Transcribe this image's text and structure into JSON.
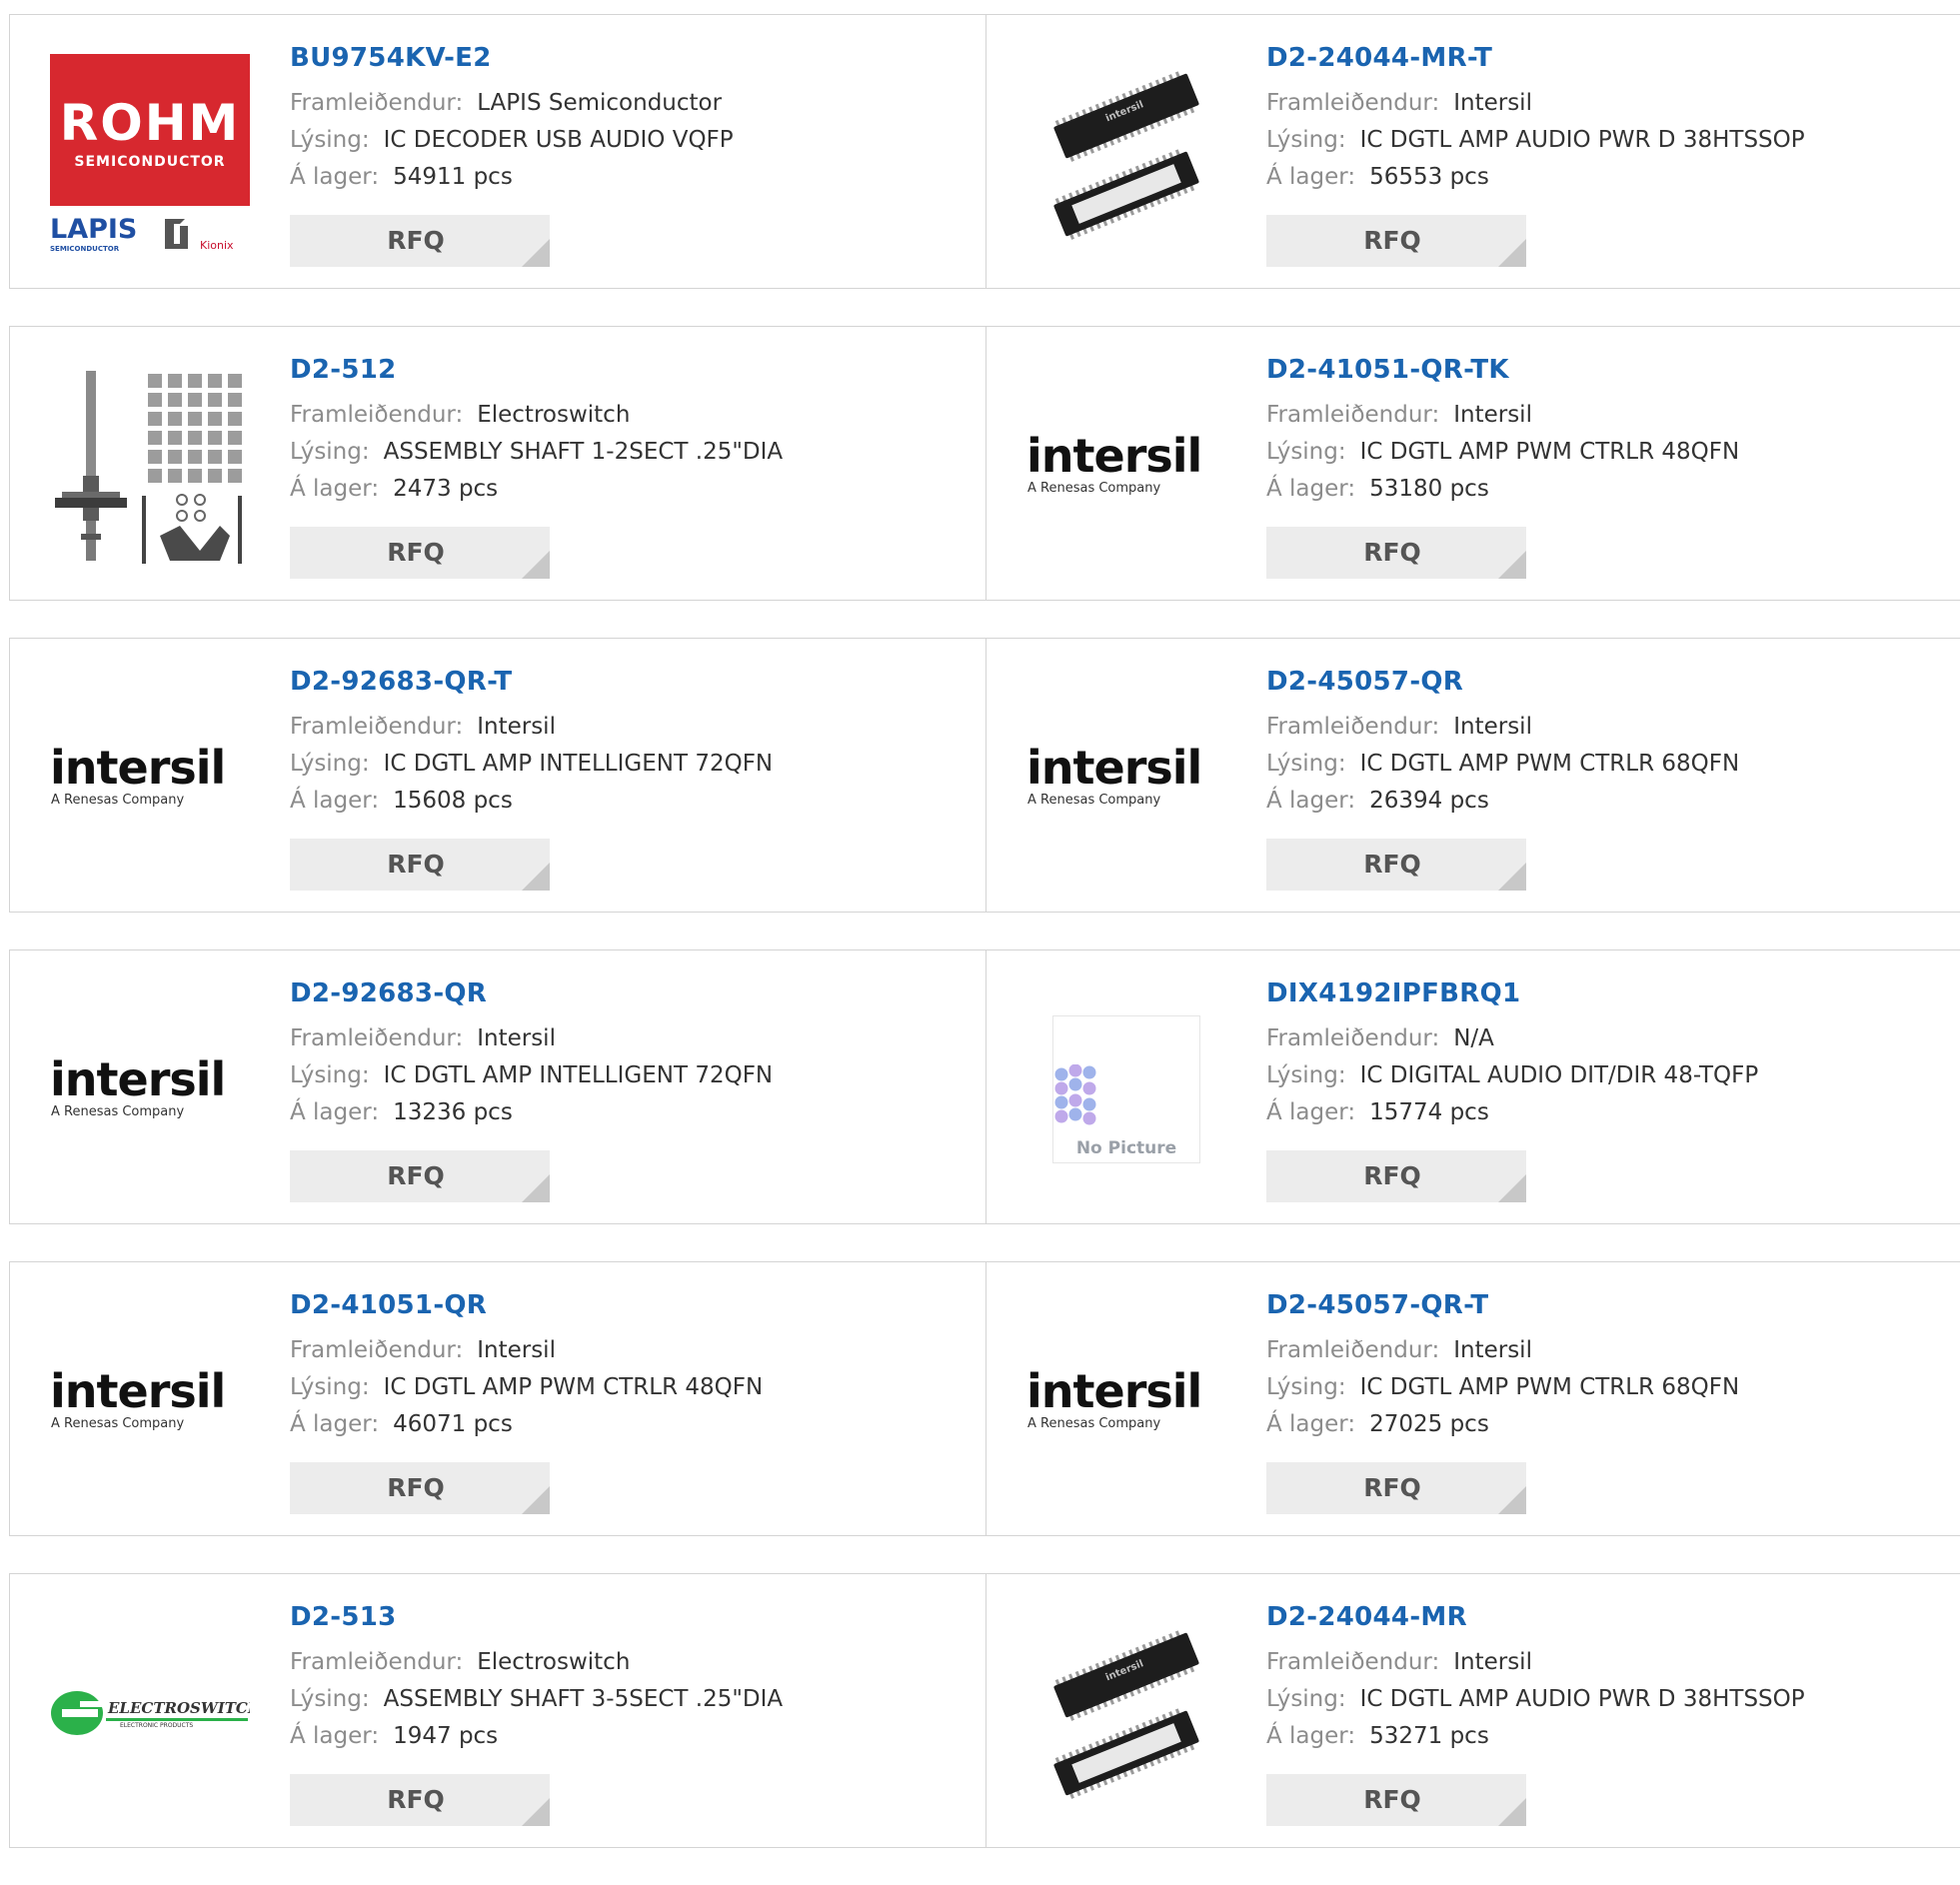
{
  "labels": {
    "manufacturer": "Framleiðendur:",
    "description": "Lýsing:",
    "stock": "Á lager:",
    "rfq": "RFQ"
  },
  "logo_text": {
    "rohm_main": "ROHM",
    "rohm_sub": "SEMICONDUCTOR",
    "lapis": "LAPIS",
    "lapis_sub": "SEMICONDUCTOR",
    "kionix": "Kionix",
    "intersil": "intersil",
    "intersil_sub": "A Renesas Company",
    "electroswitch": "ELECTROSWITCH",
    "electroswitch_sub": "ELECTRONIC PRODUCTS",
    "chip_mark": "intersil",
    "no_picture": "No Picture"
  },
  "colors": {
    "title": "#1a64b0",
    "rohm_red": "#d7282f",
    "electroswitch_green": "#2bb14a",
    "nopic_blue": "#8ea6e8",
    "nopic_purple": "#b49ae6"
  },
  "products": [
    {
      "part": "BU9754KV-E2",
      "manufacturer": "LAPIS Semiconductor",
      "description": "IC DECODER USB AUDIO VQFP",
      "stock": "54911 pcs",
      "image": "rohm-lapis-logo"
    },
    {
      "part": "D2-24044-MR-T",
      "manufacturer": "Intersil",
      "description": "IC DGTL AMP AUDIO PWR D 38HTSSOP",
      "stock": "56553 pcs",
      "image": "htssop-chip-photo"
    },
    {
      "part": "D2-512",
      "manufacturer": "Electroswitch",
      "description": "ASSEMBLY SHAFT 1-2SECT .25\"DIA",
      "stock": "2473 pcs",
      "image": "shaft-assembly-photo"
    },
    {
      "part": "D2-41051-QR-TK",
      "manufacturer": "Intersil",
      "description": "IC DGTL AMP PWM CTRLR 48QFN",
      "stock": "53180 pcs",
      "image": "intersil-logo"
    },
    {
      "part": "D2-92683-QR-T",
      "manufacturer": "Intersil",
      "description": "IC DGTL AMP INTELLIGENT 72QFN",
      "stock": "15608 pcs",
      "image": "intersil-logo"
    },
    {
      "part": "D2-45057-QR",
      "manufacturer": "Intersil",
      "description": "IC DGTL AMP PWM CTRLR 68QFN",
      "stock": "26394 pcs",
      "image": "intersil-logo"
    },
    {
      "part": "D2-92683-QR",
      "manufacturer": "Intersil",
      "description": "IC DGTL AMP INTELLIGENT 72QFN",
      "stock": "13236 pcs",
      "image": "intersil-logo"
    },
    {
      "part": "DIX4192IPFBRQ1",
      "manufacturer": "N/A",
      "description": "IC DIGITAL AUDIO DIT/DIR 48-TQFP",
      "stock": "15774 pcs",
      "image": "no-picture"
    },
    {
      "part": "D2-41051-QR",
      "manufacturer": "Intersil",
      "description": "IC DGTL AMP PWM CTRLR 48QFN",
      "stock": "46071 pcs",
      "image": "intersil-logo"
    },
    {
      "part": "D2-45057-QR-T",
      "manufacturer": "Intersil",
      "description": "IC DGTL AMP PWM CTRLR 68QFN",
      "stock": "27025 pcs",
      "image": "intersil-logo"
    },
    {
      "part": "D2-513",
      "manufacturer": "Electroswitch",
      "description": "ASSEMBLY SHAFT 3-5SECT .25\"DIA",
      "stock": "1947 pcs",
      "image": "electroswitch-logo"
    },
    {
      "part": "D2-24044-MR",
      "manufacturer": "Intersil",
      "description": "IC DGTL AMP AUDIO PWR D 38HTSSOP",
      "stock": "53271 pcs",
      "image": "htssop-chip-photo"
    }
  ]
}
